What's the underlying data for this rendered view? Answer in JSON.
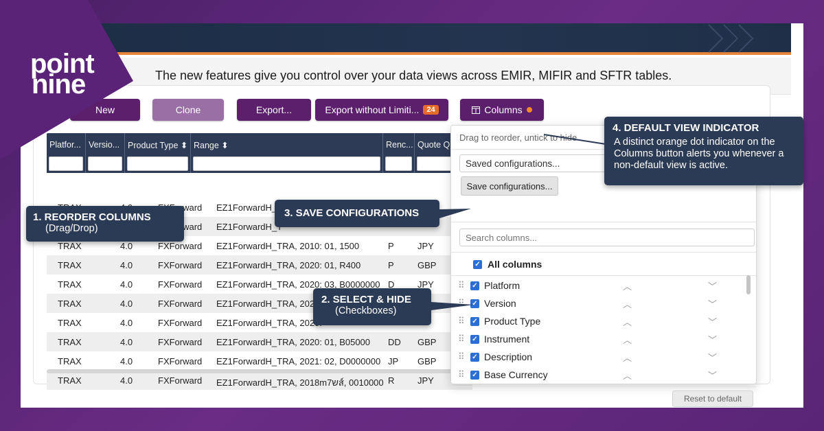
{
  "brand": {
    "logo_line1": "point",
    "logo_line2": "nine"
  },
  "intro": "The new features give you control over your data views across EMIR, MIFIR and SFTR tables.",
  "toolbar": {
    "new": "New",
    "clone": "Clone",
    "export": "Export...",
    "export_without_limit": "Export without Limiti...",
    "export_badge": "24",
    "columns": "Columns"
  },
  "table": {
    "headers": [
      "Platfor...",
      "Versio...",
      "Product Type ⬍",
      "Range ⬍",
      "Renc...",
      "Quote Qurre..."
    ],
    "rows": [
      [
        "TRAX",
        "4.0",
        "FXForward",
        "EZ1ForwardH_T",
        "",
        ""
      ],
      [
        "TRAX",
        "4.0",
        "FXForward",
        "EZ1ForwardH_T",
        "",
        ""
      ],
      [
        "TRAX",
        "4.0",
        "FXForward",
        "EZ1ForwardH_TRA, 2010: 01, 1500",
        "P",
        "JPY"
      ],
      [
        "TRAX",
        "4.0",
        "FXForward",
        "EZ1ForwardH_TRA, 2020: 01, R400",
        "P",
        "GBP"
      ],
      [
        "TRAX",
        "4.0",
        "FXForward",
        "EZ1ForwardH_TRA, 2020: 03, B0000000",
        "D",
        "JPY"
      ],
      [
        "TRAX",
        "4.0",
        "FXForward",
        "EZ1ForwardH_TRA, 2020:",
        "",
        ""
      ],
      [
        "TRAX",
        "4.0",
        "FXForward",
        "EZ1ForwardH_TRA, 2020:",
        "",
        ""
      ],
      [
        "TRAX",
        "4.0",
        "FXForward",
        "EZ1ForwardH_TRA, 2020: 01, B05000",
        "DD",
        "GBP"
      ],
      [
        "TRAX",
        "4.0",
        "FXForward",
        "EZ1ForwardH_TRA, 2021: 02, D0000000",
        "JP",
        "GBP"
      ],
      [
        "TRAX",
        "4.0",
        "FXForward",
        "EZ1ForwardH_TRA, 2018mש7ส์, 0010000",
        "R",
        "JPY"
      ]
    ]
  },
  "columns_panel": {
    "hint": "Drag to reorder, untick to hide",
    "saved_select": "Saved configurations...",
    "save_button": "Save configurations...",
    "search_placeholder": "Search columns...",
    "all_columns": "All columns",
    "items": [
      "Platform",
      "Version",
      "Product Type",
      "Instrument",
      "Description",
      "Base Currency"
    ],
    "reset": "Reset to default"
  },
  "callouts": {
    "c1_title": "1. REORDER COLUMNS",
    "c1_sub": "(Drag/Drop)",
    "c2_title": "2. SELECT & HIDE",
    "c2_sub": "(Checkboxes)",
    "c3_title": "3. SAVE CONFIGURATIONS",
    "c4_title": "4. DEFAULT VIEW INDICATOR",
    "c4_body": "A distinct orange dot indicator on the Columns button alerts you whenever a non-default view is active."
  },
  "colors": {
    "accent_orange": "#e8843a",
    "button_purple": "#5b1f6b",
    "callout_navy": "#2b3a55",
    "checkbox_blue": "#2b6fd6"
  }
}
